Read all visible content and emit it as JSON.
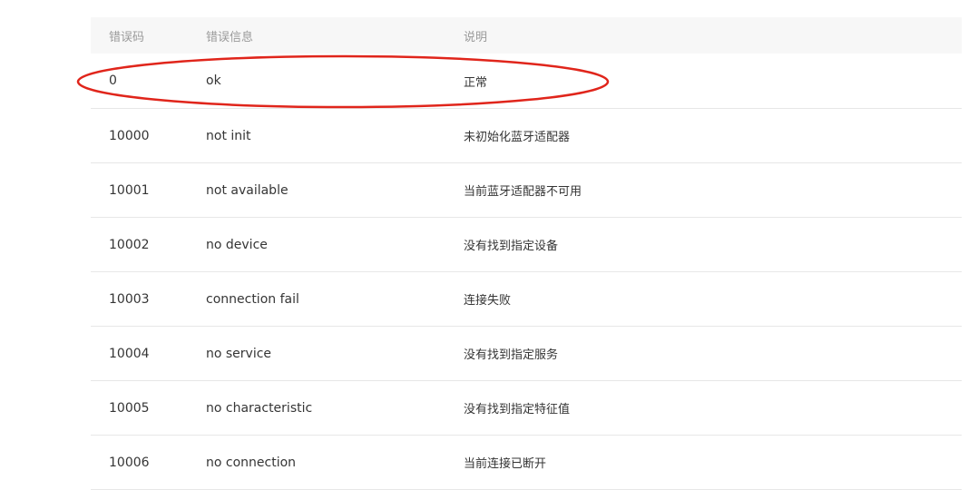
{
  "header": {
    "code": "错误码",
    "message": "错误信息",
    "description": "说明"
  },
  "rows": [
    {
      "code": "0",
      "message": "ok",
      "description": "正常"
    },
    {
      "code": "10000",
      "message": "not init",
      "description": "未初始化蓝牙适配器"
    },
    {
      "code": "10001",
      "message": "not available",
      "description": "当前蓝牙适配器不可用"
    },
    {
      "code": "10002",
      "message": "no device",
      "description": "没有找到指定设备"
    },
    {
      "code": "10003",
      "message": "connection fail",
      "description": "连接失败"
    },
    {
      "code": "10004",
      "message": "no service",
      "description": "没有找到指定服务"
    },
    {
      "code": "10005",
      "message": "no characteristic",
      "description": "没有找到指定特征值"
    },
    {
      "code": "10006",
      "message": "no connection",
      "description": "当前连接已断开"
    }
  ],
  "annotation": {
    "color": "#e0251b",
    "highlighted_row": "0"
  }
}
